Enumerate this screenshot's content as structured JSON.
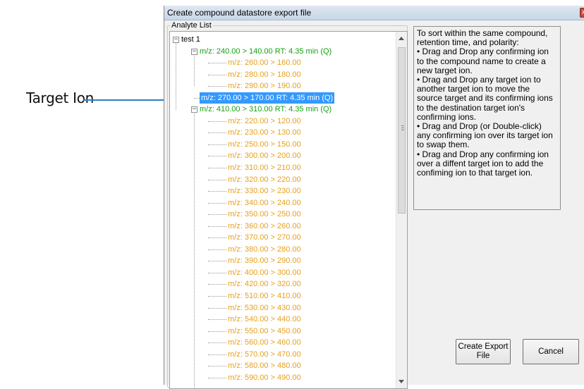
{
  "callout": {
    "label": "Target Ion"
  },
  "window": {
    "title": "Create compound datastore export file",
    "close_glyph": "x"
  },
  "analyte_group": {
    "label": "Analyte List"
  },
  "tree": {
    "root": "test 1",
    "rows": [
      {
        "text": "test 1",
        "level": 0,
        "type": "root",
        "expander": "−"
      },
      {
        "text": "m/z: 240.00 > 140.00  RT: 4.35 min (Q)",
        "level": 1,
        "type": "target",
        "expander": "−"
      },
      {
        "text": "m/z: 260.00 > 160.00",
        "level": 2,
        "type": "confirm"
      },
      {
        "text": "m/z: 280.00 > 180.00",
        "level": 2,
        "type": "confirm"
      },
      {
        "text": "m/z: 290.00 > 190.00",
        "level": 2,
        "type": "confirm",
        "last": true
      },
      {
        "text": "m/z: 270.00 > 170.00  RT: 4.35 min (Q)",
        "level": 1,
        "type": "target-selected"
      },
      {
        "text": "m/z: 410.00 > 310.00  RT: 4.35 min (Q)",
        "level": 1,
        "type": "target",
        "expander": "−"
      },
      {
        "text": "m/z: 220.00 > 120.00",
        "level": 2,
        "type": "confirm"
      },
      {
        "text": "m/z: 230.00 > 130.00",
        "level": 2,
        "type": "confirm"
      },
      {
        "text": "m/z: 250.00 > 150.00",
        "level": 2,
        "type": "confirm"
      },
      {
        "text": "m/z: 300.00 > 200.00",
        "level": 2,
        "type": "confirm"
      },
      {
        "text": "m/z: 310.00 > 210.00",
        "level": 2,
        "type": "confirm"
      },
      {
        "text": "m/z: 320.00 > 220.00",
        "level": 2,
        "type": "confirm"
      },
      {
        "text": "m/z: 330.00 > 230.00",
        "level": 2,
        "type": "confirm"
      },
      {
        "text": "m/z: 340.00 > 240.00",
        "level": 2,
        "type": "confirm"
      },
      {
        "text": "m/z: 350.00 > 250.00",
        "level": 2,
        "type": "confirm"
      },
      {
        "text": "m/z: 360.00 > 260.00",
        "level": 2,
        "type": "confirm"
      },
      {
        "text": "m/z: 370.00 > 270.00",
        "level": 2,
        "type": "confirm"
      },
      {
        "text": "m/z: 380.00 > 280.00",
        "level": 2,
        "type": "confirm"
      },
      {
        "text": "m/z: 390.00 > 290.00",
        "level": 2,
        "type": "confirm"
      },
      {
        "text": "m/z: 400.00 > 300.00",
        "level": 2,
        "type": "confirm"
      },
      {
        "text": "m/z: 420.00 > 320.00",
        "level": 2,
        "type": "confirm"
      },
      {
        "text": "m/z: 510.00 > 410.00",
        "level": 2,
        "type": "confirm"
      },
      {
        "text": "m/z: 530.00 > 430.00",
        "level": 2,
        "type": "confirm"
      },
      {
        "text": "m/z: 540.00 > 440.00",
        "level": 2,
        "type": "confirm"
      },
      {
        "text": "m/z: 550.00 > 450.00",
        "level": 2,
        "type": "confirm"
      },
      {
        "text": "m/z: 560.00 > 460.00",
        "level": 2,
        "type": "confirm"
      },
      {
        "text": "m/z: 570.00 > 470.00",
        "level": 2,
        "type": "confirm"
      },
      {
        "text": "m/z: 580.00 > 480.00",
        "level": 2,
        "type": "confirm"
      },
      {
        "text": "m/z: 590.00 > 490.00",
        "level": 2,
        "type": "confirm"
      }
    ]
  },
  "help": {
    "lines": [
      "To sort within the same compound, retention time, and polarity:",
      "• Drag and Drop any confirming ion to the compound name to create a new target ion.",
      "• Drag and Drop any target ion to another target ion to move the source target and its confirming ions to the destination target ion's confirming ions.",
      "• Drag and Drop (or Double-click) any confirming ion over its target ion to swap them.",
      "• Drag and Drop any confirming ion over a diffent target ion to add the confiming ion to that target ion."
    ]
  },
  "buttons": {
    "export_line1": "Create Export",
    "export_line2": "File",
    "cancel": "Cancel"
  },
  "colors": {
    "target": "#14a214",
    "confirm": "#e6a01c",
    "selection": "#3399ff",
    "callout_line": "#2f7fc4"
  },
  "icons": {
    "expander": "minus-box-icon",
    "scroll_up": "triangle-up-icon",
    "scroll_down": "triangle-down-icon",
    "close": "close-icon"
  }
}
